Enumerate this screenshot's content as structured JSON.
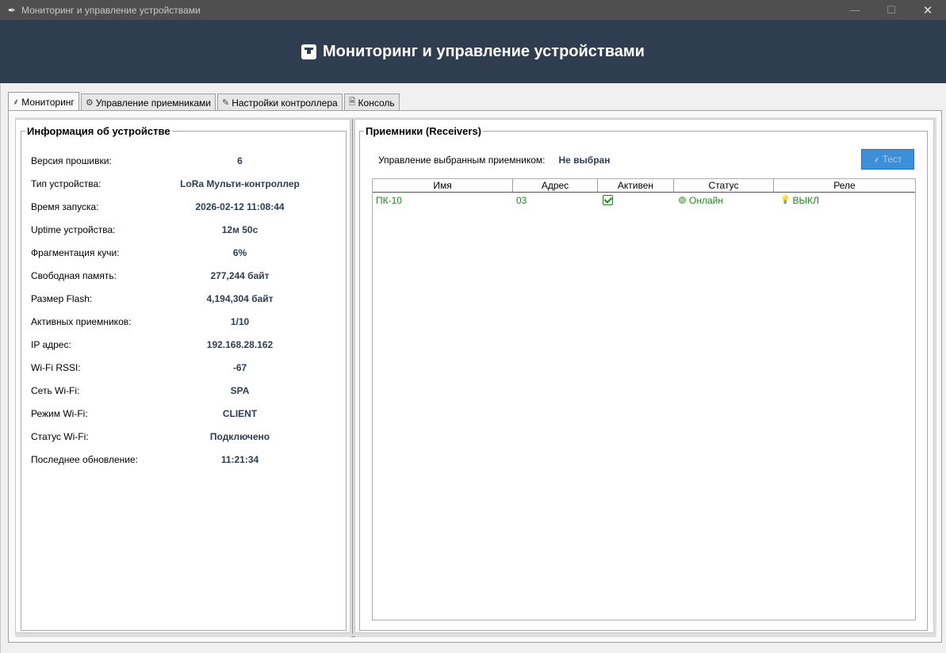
{
  "window": {
    "title": "Мониторинг и управление устройствами",
    "app_icon": "feather-icon",
    "minimize_glyph": "—",
    "maximize_glyph": "☐",
    "close_glyph": "✕"
  },
  "header": {
    "icon": "device-icon",
    "title": "Мониторинг и управление устройствами"
  },
  "tabs": [
    {
      "icon": "⸙",
      "label": "Мониторинг",
      "active": true
    },
    {
      "icon": "⚙",
      "label": "Управление приемниками",
      "active": false
    },
    {
      "icon": "✎",
      "label": "Настройки контроллера",
      "active": false
    },
    {
      "icon": "🗎",
      "label": "Консоль",
      "active": false
    }
  ],
  "device_info": {
    "legend": "Информация об устройстве",
    "rows": [
      {
        "label": "Версия прошивки:",
        "value": "6"
      },
      {
        "label": "Тип устройства:",
        "value": "LoRa Мульти-контроллер"
      },
      {
        "label": "Время запуска:",
        "value": "2026-02-12 11:08:44"
      },
      {
        "label": "Uptime устройства:",
        "value": "12м 50с"
      },
      {
        "label": "Фрагментация кучи:",
        "value": "6%"
      },
      {
        "label": "Свободная память:",
        "value": "277,244 байт"
      },
      {
        "label": "Размер Flash:",
        "value": "4,194,304 байт"
      },
      {
        "label": "Активных приемников:",
        "value": "1/10"
      },
      {
        "label": "IP адрес:",
        "value": "192.168.28.162"
      },
      {
        "label": "Wi-Fi RSSI:",
        "value": "-67"
      },
      {
        "label": "Сеть Wi-Fi:",
        "value": "SPA"
      },
      {
        "label": "Режим Wi-Fi:",
        "value": "CLIENT"
      },
      {
        "label": "Статус Wi-Fi:",
        "value": "Подключено"
      },
      {
        "label": "Последнее обновление:",
        "value": "11:21:34"
      }
    ]
  },
  "receivers": {
    "legend": "Приемники (Receivers)",
    "selected_label": "Управление выбранным приемником:",
    "selected_value": "Не выбран",
    "test_button": {
      "icon": "⸙",
      "label": "Тест",
      "enabled": false
    },
    "columns": [
      "Имя",
      "Адрес",
      "Активен",
      "Статус",
      "Реле"
    ],
    "rows": [
      {
        "name": "ПК-10",
        "address": "03",
        "active": true,
        "status": "Онлайн",
        "relay": "ВЫКЛ"
      }
    ],
    "colors": {
      "online": "#1a8a1a",
      "accent": "#2e3e50",
      "button": "#3d8fd7"
    }
  }
}
